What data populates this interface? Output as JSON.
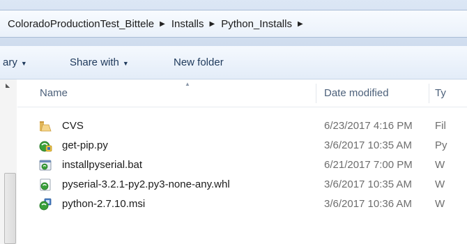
{
  "address": {
    "crumbs": [
      "ColoradoProductionTest_Bittele",
      "Installs",
      "Python_Installs"
    ],
    "separator": "▶"
  },
  "toolbar": {
    "library_label": "ary",
    "share_label": "Share with",
    "new_folder_label": "New folder"
  },
  "columns": {
    "name": "Name",
    "date": "Date modified",
    "type": "Ty"
  },
  "files": [
    {
      "name": "CVS",
      "date": "6/23/2017 4:16 PM",
      "type": "Fil",
      "icon": "folder-icon"
    },
    {
      "name": "get-pip.py",
      "date": "3/6/2017 10:35 AM",
      "type": "Py",
      "icon": "python-file-icon"
    },
    {
      "name": "installpyserial.bat",
      "date": "6/21/2017 7:00 PM",
      "type": "W",
      "icon": "batch-file-icon"
    },
    {
      "name": "pyserial-3.2.1-py2.py3-none-any.whl",
      "date": "3/6/2017 10:35 AM",
      "type": "W",
      "icon": "whl-file-icon"
    },
    {
      "name": "python-2.7.10.msi",
      "date": "3/6/2017 10:36 AM",
      "type": "W",
      "icon": "msi-installer-icon"
    }
  ],
  "colors": {
    "toolbar_text": "#1e395b",
    "header_text": "#4c607a",
    "date_text": "#6d6d6d"
  }
}
